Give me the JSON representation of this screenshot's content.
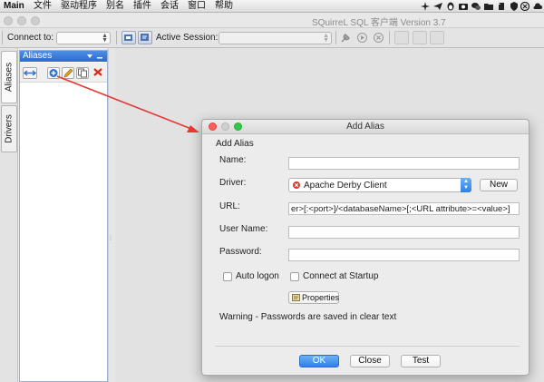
{
  "menubar": {
    "app_name": "Main",
    "items": [
      {
        "label": "文件"
      },
      {
        "label": "驱动程序"
      },
      {
        "label": "别名"
      },
      {
        "label": "插件"
      },
      {
        "label": "会话"
      },
      {
        "label": "窗口"
      },
      {
        "label": "帮助"
      }
    ],
    "status_icons": [
      "airplane-icon",
      "telegram-icon",
      "penguin-icon",
      "camera-icon",
      "wechat-icon",
      "folder-icon",
      "evernote-icon",
      "shield-icon",
      "gear-icon",
      "xunlei-icon",
      "cloud-icon"
    ]
  },
  "window": {
    "title": "SQuirreL SQL 客户端 Version 3.7"
  },
  "toolbar": {
    "connect_label": "Connect to:",
    "connect_value": "",
    "active_session_label": "Active Session:",
    "active_session_value": ""
  },
  "sidebar": {
    "tabs": [
      {
        "label": "Aliases"
      },
      {
        "label": "Drivers"
      }
    ]
  },
  "aliases_panel": {
    "title": "Aliases",
    "buttons": [
      "connect-icon",
      "add-icon",
      "edit-icon",
      "copy-icon",
      "delete-icon"
    ]
  },
  "dialog": {
    "window_title": "Add Alias",
    "heading": "Add Alias",
    "name_label": "Name:",
    "name_value": "",
    "driver_label": "Driver:",
    "driver_value": "Apache Derby Client",
    "new_button": "New",
    "url_label": "URL:",
    "url_value": "er>[:<port>]/<databaseName>[;<URL attribute>=<value>]",
    "username_label": "User Name:",
    "username_value": "",
    "password_label": "Password:",
    "password_value": "",
    "auto_logon_label": "Auto logon",
    "auto_logon_checked": false,
    "connect_startup_label": "Connect at Startup",
    "connect_startup_checked": false,
    "properties_button": "Properties",
    "warning": "Warning - Passwords are saved in clear text",
    "ok_button": "OK",
    "close_button": "Close",
    "test_button": "Test"
  },
  "colors": {
    "panel_header": "#2a6ad1",
    "primary_button": "#2f7fe8",
    "annotation_arrow": "#e53935",
    "driver_error": "#d93a2f"
  }
}
